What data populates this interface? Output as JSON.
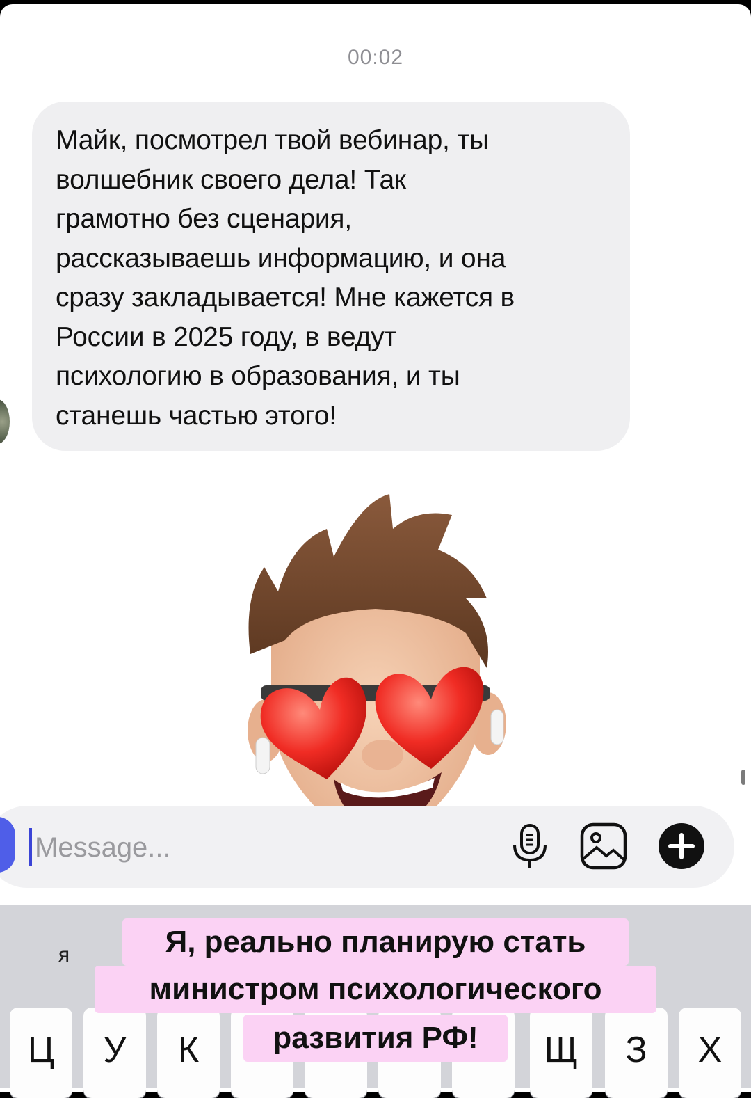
{
  "chat": {
    "timestamp": "00:02",
    "message_text": "Майк, посмотрел твой вебинар, ты\nволшебник своего дела! Так\nграмотно без сценария,\nрассказываешь информацию, и она\nсразу закладывается! Мне кажется в\nРоссии в 2025 году, в ведут\nпсихологию в образования, и ты\nстанешь частью этого!",
    "sticker": "memoji-heart-eyes-sticker"
  },
  "composer": {
    "placeholder": "Message...",
    "value": "",
    "icons": [
      "microphone-icon",
      "gallery-icon",
      "plus-icon"
    ]
  },
  "keyboard": {
    "suggestion": "я",
    "keys": [
      "Ц",
      "У",
      "К",
      "Щ",
      "З",
      "Х"
    ]
  },
  "caption": {
    "line1": "Я, реально планирую стать",
    "line2": "министром психологического",
    "line3": "развития РФ!"
  },
  "colors": {
    "bubble": "#efeff1",
    "caption_bg": "#fbd2f4",
    "accent": "#4f5ee8",
    "keyboard_bg": "#d3d4d9"
  }
}
